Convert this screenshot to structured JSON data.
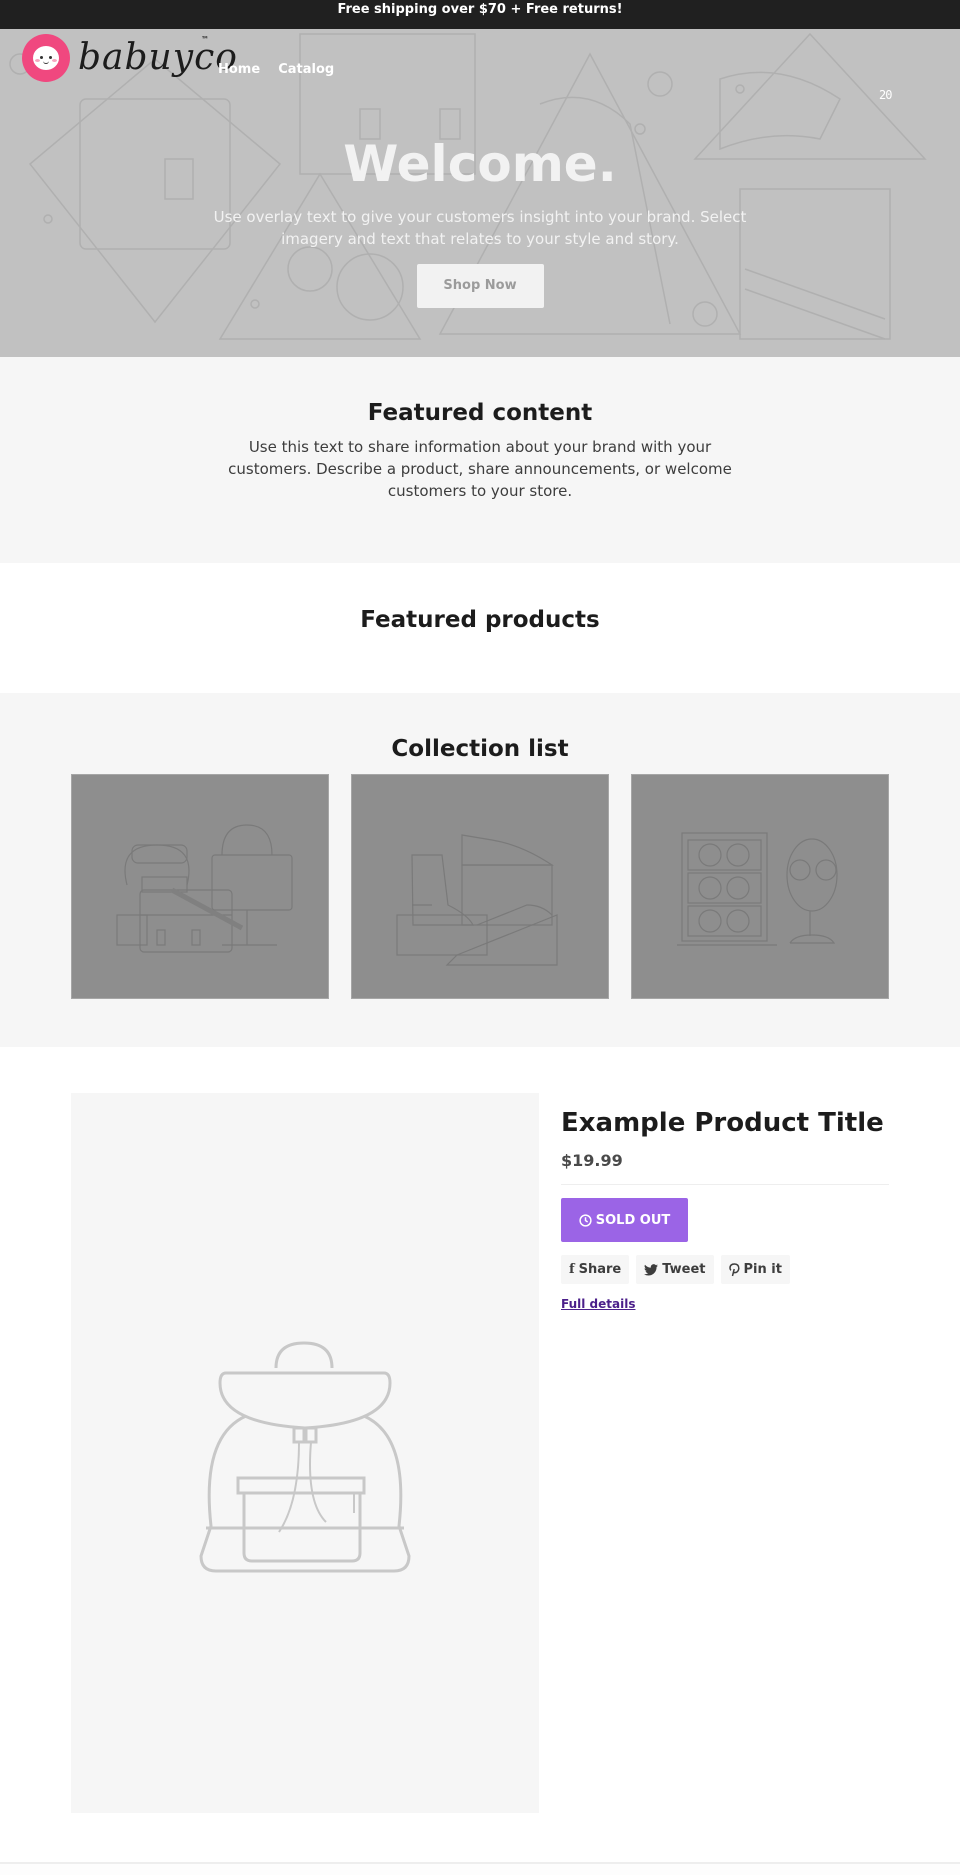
{
  "announcement": {
    "text": "Free shipping over $70 + Free returns!"
  },
  "header": {
    "logo_text": "babuyco",
    "logo_tm": "™",
    "nav": [
      {
        "label": "Home"
      },
      {
        "label": "Catalog"
      }
    ],
    "cart_icon": "cart-icon",
    "cart_label": "20"
  },
  "hero": {
    "title": "Welcome.",
    "subtitle": "Use overlay text to give your customers insight into your brand. Select imagery and text that relates to your style and story.",
    "button_label": "Shop Now"
  },
  "featured_content": {
    "title": "Featured content",
    "text": "Use this text to share information about your brand with your customers. Describe a product, share announcements, or welcome customers to your store."
  },
  "featured_products": {
    "title": "Featured products"
  },
  "collection_list": {
    "title": "Collection list",
    "items": [
      {
        "icon": "bags-illustration"
      },
      {
        "icon": "shoes-illustration"
      },
      {
        "icon": "eyewear-illustration"
      }
    ]
  },
  "product": {
    "title": "Example Product Title",
    "price": "$19.99",
    "sold_out_label": "SOLD OUT",
    "share": [
      {
        "icon": "facebook-icon",
        "label": "Share"
      },
      {
        "icon": "twitter-icon",
        "label": "Tweet"
      },
      {
        "icon": "pinterest-icon",
        "label": "Pin it"
      }
    ],
    "full_details_label": "Full details",
    "image_icon": "backpack-illustration"
  },
  "colors": {
    "announcement_bg": "#202020",
    "hero_bg": "#c1c1c1",
    "section_alt_bg": "#f6f6f6",
    "collection_card_bg": "#8e8e8e",
    "accent": "#9b64e6",
    "link": "#4b1f8a",
    "logo_pink": "#f0487f"
  }
}
